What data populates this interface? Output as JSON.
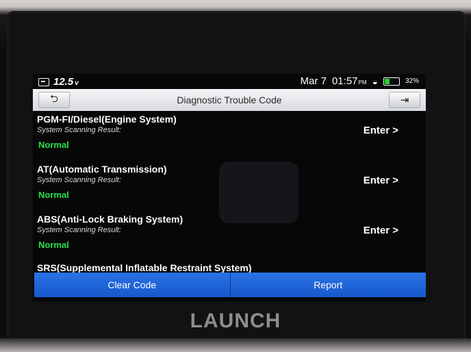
{
  "status_bar": {
    "voltage": "12.5",
    "voltage_unit": "v",
    "date": "Mar 7",
    "time": "01:57",
    "time_suffix": "PM",
    "battery_percent": "32%"
  },
  "header": {
    "title": "Diagnostic Trouble Code"
  },
  "systems": [
    {
      "name": "PGM-FI/Diesel(Engine System)",
      "label": "System Scanning Result:",
      "status": "Normal",
      "action": "Enter >"
    },
    {
      "name": "AT(Automatic Transmission)",
      "label": "System Scanning Result:",
      "status": "Normal",
      "action": "Enter >"
    },
    {
      "name": "ABS(Anti-Lock Braking System)",
      "label": "System Scanning Result:",
      "status": "Normal",
      "action": "Enter >"
    },
    {
      "name": "SRS(Supplemental Inflatable Restraint System)"
    }
  ],
  "footer": {
    "clear_code": "Clear Code",
    "report": "Report"
  },
  "device": {
    "brand": "LAUNCH"
  },
  "colors": {
    "accent_blue": "#1f66da",
    "status_green": "#29e04a",
    "title_bar": "#e5e6e9"
  }
}
